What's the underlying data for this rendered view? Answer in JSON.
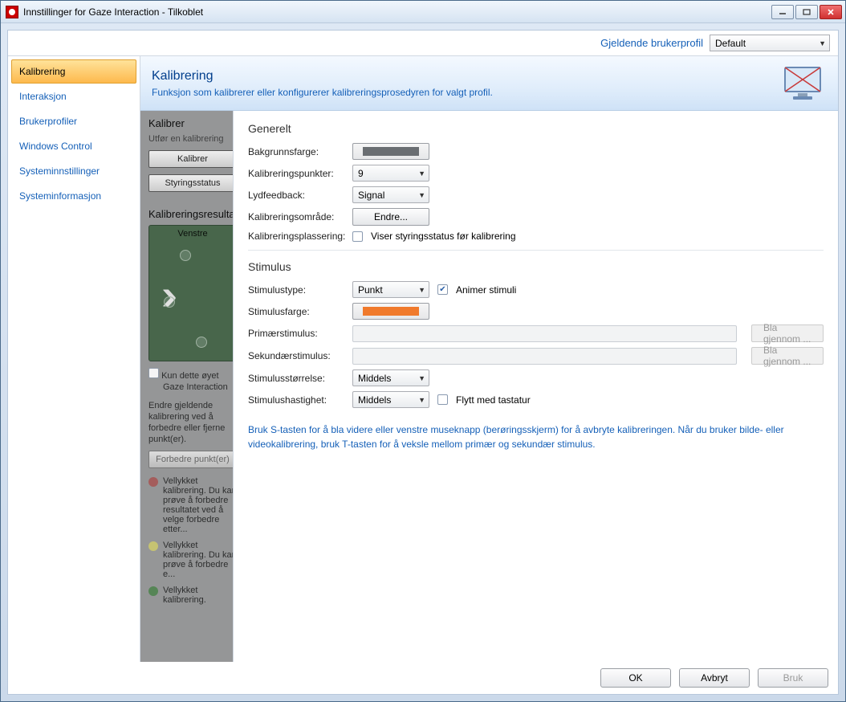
{
  "window": {
    "title": "Innstillinger for Gaze Interaction - Tilkoblet"
  },
  "profile": {
    "label": "Gjeldende brukerprofil",
    "value": "Default"
  },
  "sidebar": {
    "items": [
      {
        "label": "Kalibrering",
        "active": true
      },
      {
        "label": "Interaksjon"
      },
      {
        "label": "Brukerprofiler"
      },
      {
        "label": "Windows Control"
      },
      {
        "label": "Systeminnstillinger"
      },
      {
        "label": "Systeminformasjon"
      }
    ]
  },
  "header": {
    "title": "Kalibrering",
    "desc": "Funksjon som kalibrerer eller konfigurerer kalibreringsprosedyren for valgt profil."
  },
  "backpanel": {
    "h1": "Kalibrer",
    "sub1": "Utfør en kalibrering",
    "btn1": "Kalibrer",
    "btn2": "Styringsstatus",
    "h2": "Kalibreringsresultat",
    "green_head": "Venstre",
    "chk_label": "Kun dette øyet",
    "chk_sub": "Gaze Interaction",
    "para": "Endre gjeldende kalibrering ved å forbedre eller fjerne punkt(er).",
    "improve_btn": "Forbedre punkt(er)",
    "legend_r": "Vellykket kalibrering. Du kan prøve å forbedre resultatet ved å velge forbedre etter...",
    "legend_y": "Vellykket kalibrering. Du kan prøve å forbedre e...",
    "legend_g": "Vellykket kalibrering."
  },
  "general": {
    "title": "Generelt",
    "bg_label": "Bakgrunnsfarge:",
    "bg_color": "#6a6e72",
    "pts_label": "Kalibreringspunkter:",
    "pts_value": "9",
    "snd_label": "Lydfeedback:",
    "snd_value": "Signal",
    "area_label": "Kalibreringsområde:",
    "area_btn": "Endre...",
    "place_label": "Kalibreringsplassering:",
    "place_chk": "Viser styringsstatus før kalibrering",
    "place_checked": false
  },
  "stimulus": {
    "title": "Stimulus",
    "type_label": "Stimulustype:",
    "type_value": "Punkt",
    "anim_label": "Animer stimuli",
    "anim_checked": true,
    "color_label": "Stimulusfarge:",
    "color_value": "#f07a2c",
    "prim_label": "Primærstimulus:",
    "sec_label": "Sekundærstimulus:",
    "browse": "Bla gjennom ...",
    "size_label": "Stimulusstørrelse:",
    "size_value": "Middels",
    "speed_label": "Stimulushastighet:",
    "speed_value": "Middels",
    "kbd_label": "Flytt med tastatur",
    "kbd_checked": false
  },
  "help": "Bruk S-tasten for å bla videre eller venstre museknapp (berøringsskjerm) for å avbryte kalibreringen. Når du bruker bilde- eller videokalibrering, bruk T-tasten for å veksle mellom primær og sekundær stimulus.",
  "footer": {
    "ok": "OK",
    "cancel": "Avbryt",
    "apply": "Bruk"
  }
}
